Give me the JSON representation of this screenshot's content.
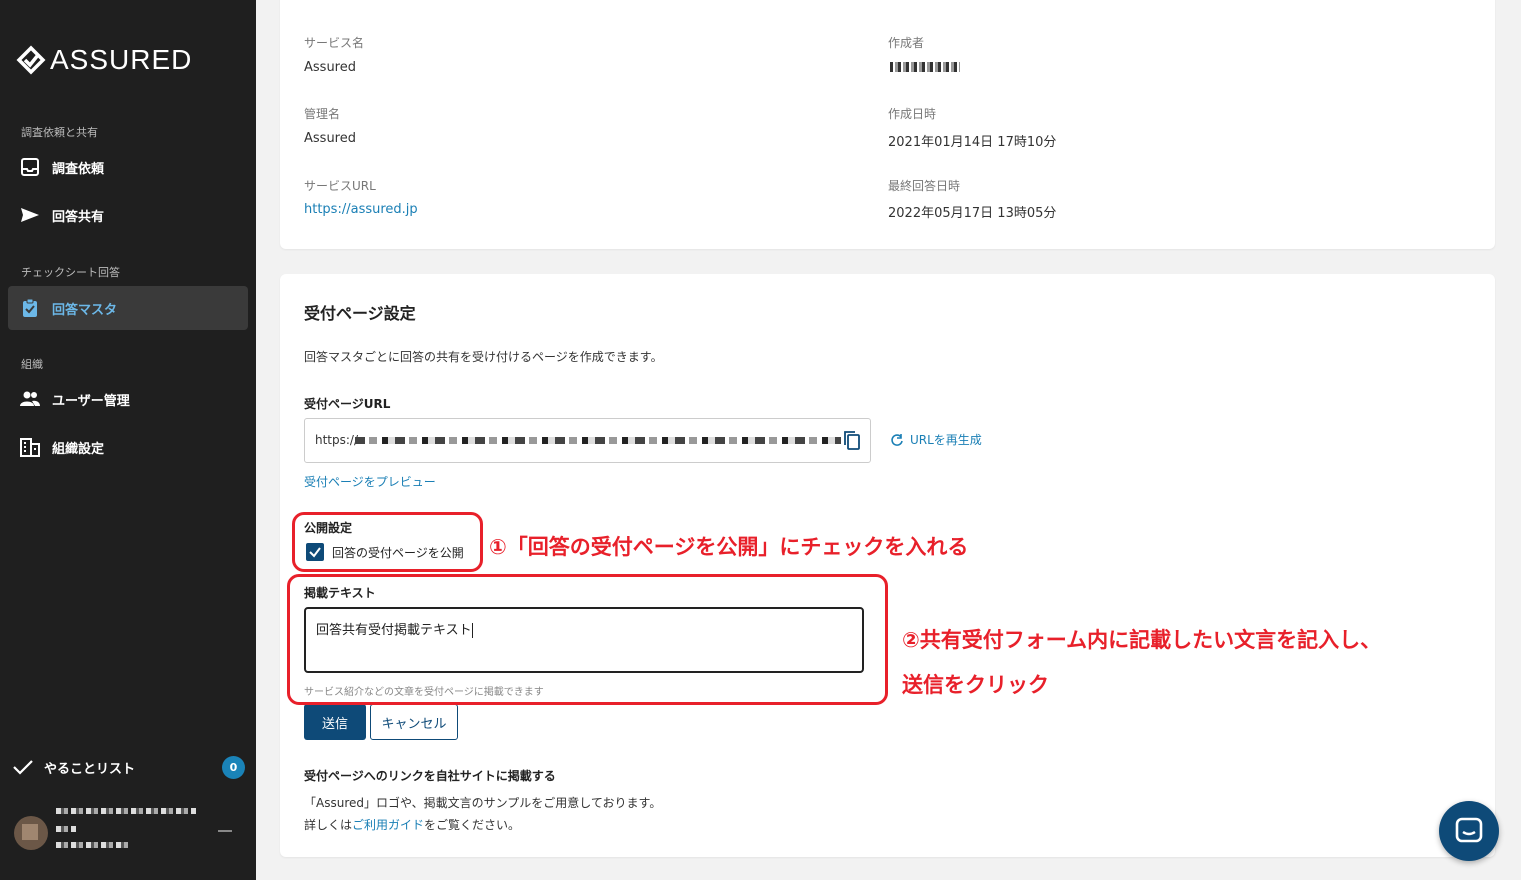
{
  "sidebar": {
    "logo_text": "ASSURED",
    "sections": {
      "request": "調査依頼と共有",
      "checksheet": "チェックシート回答",
      "org": "組織"
    },
    "items": [
      {
        "label": "調査依頼",
        "icon": "inbox-icon"
      },
      {
        "label": "回答共有",
        "icon": "send-icon"
      },
      {
        "label": "回答マスタ",
        "icon": "clipboard-check-icon",
        "active": true
      },
      {
        "label": "ユーザー管理",
        "icon": "people-icon"
      },
      {
        "label": "組織設定",
        "icon": "building-icon"
      }
    ],
    "todo": {
      "label": "やることリスト",
      "count": "0"
    }
  },
  "details": {
    "service_name_label": "サービス名",
    "service_name": "Assured",
    "creator_label": "作成者",
    "admin_name_label": "管理名",
    "admin_name": "Assured",
    "created_at_label": "作成日時",
    "created_at": "2021年01月14日 17時10分",
    "service_url_label": "サービスURL",
    "service_url": "https://assured.jp",
    "last_answered_label": "最終回答日時",
    "last_answered": "2022年05月17日 13時05分"
  },
  "reception": {
    "title": "受付ページ設定",
    "description": "回答マスタごとに回答の共有を受け付けるページを作成できます。",
    "url_label": "受付ページURL",
    "url_prefix": "https://",
    "regenerate": "URLを再生成",
    "preview": "受付ページをプレビュー",
    "publish_label": "公開設定",
    "publish_checkbox": "回答の受付ページを公開",
    "text_label": "掲載テキスト",
    "text_value": "回答共有受付掲載テキスト",
    "text_hint": "サービス紹介などの文章を受付ページに掲載できます",
    "submit": "送信",
    "cancel": "キャンセル",
    "link_title": "受付ページへのリンクを自社サイトに掲載する",
    "link_body_1": "「Assured」ロゴや、掲載文言のサンプルをご用意しております。",
    "link_body_2_prefix": "詳しくは",
    "link_body_2_link": "ご利用ガイド",
    "link_body_2_suffix": "をご覧ください。"
  },
  "annotations": {
    "step1": "①「回答の受付ページを公開」にチェックを入れる",
    "step2_line1": "②共有受付フォーム内に記載したい文言を記入し、",
    "step2_line2": "送信をクリック"
  },
  "colors": {
    "accent": "#0e4a78",
    "link": "#1a7fb5",
    "annotation": "#e8202a",
    "sidebar_bg": "#1f1f1f"
  }
}
